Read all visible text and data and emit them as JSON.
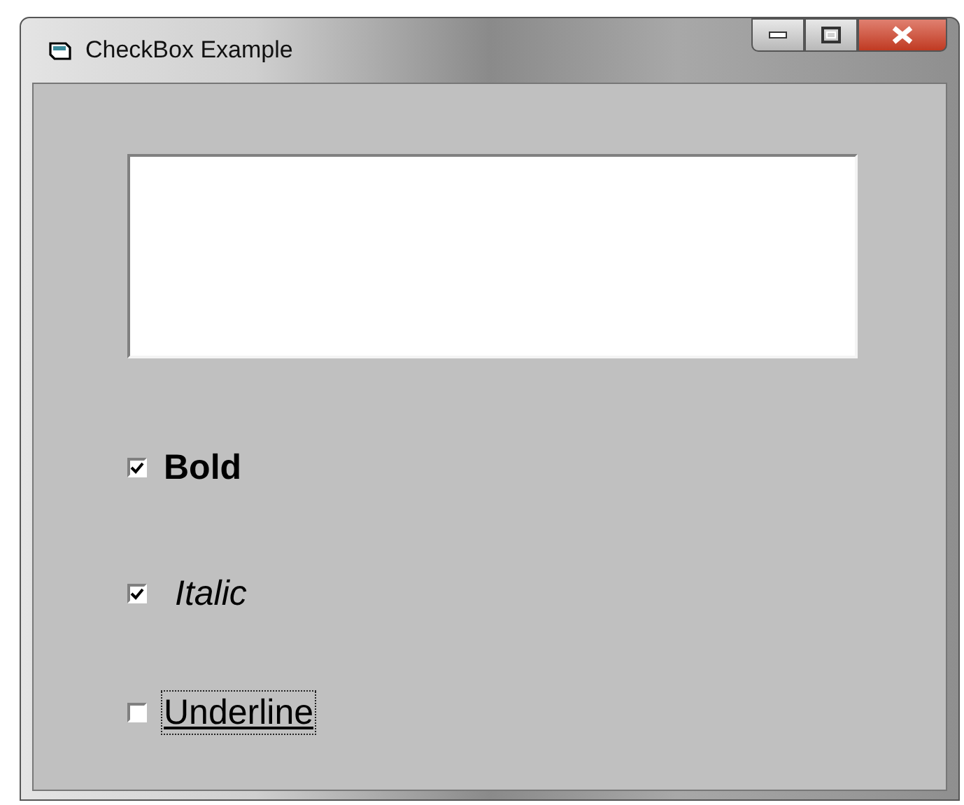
{
  "window": {
    "title": "CheckBox Example"
  },
  "checkboxes": [
    {
      "label": "Bold",
      "kind": "bold",
      "checked": true,
      "focused": false
    },
    {
      "label": "Italic",
      "kind": "italic",
      "checked": true,
      "focused": false
    },
    {
      "label": "Underline",
      "kind": "underline",
      "checked": false,
      "focused": true
    }
  ]
}
